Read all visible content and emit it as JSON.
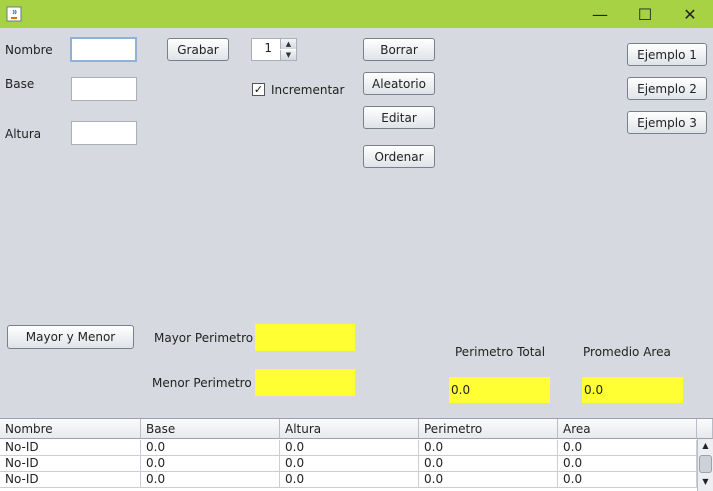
{
  "window": {
    "minimize": "—",
    "maximize": "☐",
    "close": "✕"
  },
  "form": {
    "nombre_label": "Nombre",
    "base_label": "Base",
    "altura_label": "Altura",
    "grabar_button": "Grabar",
    "spinner_value": "1",
    "incrementar_label": "Incrementar",
    "incrementar_checked": true
  },
  "actions": {
    "borrar": "Borrar",
    "aleatorio": "Aleatorio",
    "editar": "Editar",
    "ordenar": "Ordenar"
  },
  "examples": {
    "ejemplo1": "Ejemplo 1",
    "ejemplo2": "Ejemplo 2",
    "ejemplo3": "Ejemplo 3"
  },
  "stats": {
    "mayor_menor_button": "Mayor y Menor",
    "mayor_perimetro_label": "Mayor Perimetro",
    "menor_perimetro_label": "Menor Perimetro",
    "perimetro_total_label": "Perimetro Total",
    "promedio_area_label": "Promedio Area",
    "perimetro_total_value": "0.0",
    "promedio_area_value": "0.0",
    "highlight_color": "#ffff33"
  },
  "table": {
    "headers": [
      "Nombre",
      "Base",
      "Altura",
      "Perimetro",
      "Area"
    ],
    "rows": [
      [
        "No-ID",
        "0.0",
        "0.0",
        "0.0",
        "0.0"
      ],
      [
        "No-ID",
        "0.0",
        "0.0",
        "0.0",
        "0.0"
      ],
      [
        "No-ID",
        "0.0",
        "0.0",
        "0.0",
        "0.0"
      ]
    ]
  }
}
